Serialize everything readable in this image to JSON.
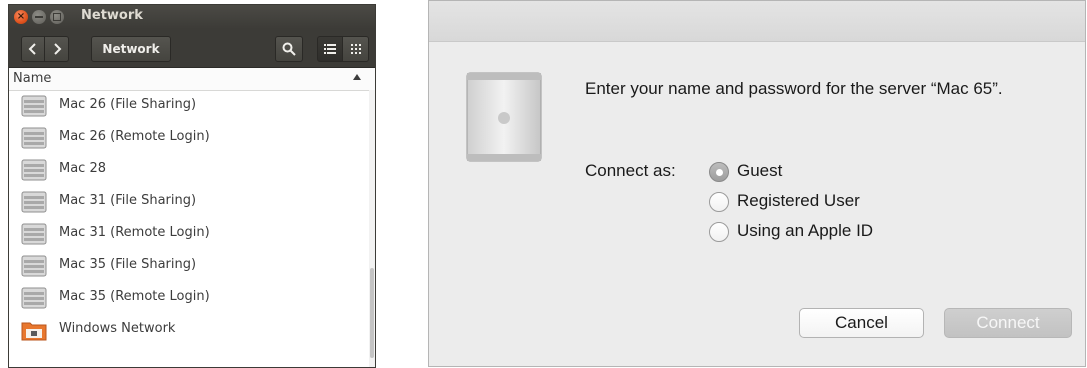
{
  "nautilus": {
    "title": "Network",
    "path_button": "Network",
    "column_header": "Name",
    "items": [
      {
        "label": "Mac 26 (File Sharing)",
        "icon": "server-icon"
      },
      {
        "label": "Mac 26 (Remote Login)",
        "icon": "server-icon"
      },
      {
        "label": "Mac 28",
        "icon": "server-icon"
      },
      {
        "label": "Mac 31 (File Sharing)",
        "icon": "server-icon"
      },
      {
        "label": "Mac 31 (Remote Login)",
        "icon": "server-icon"
      },
      {
        "label": "Mac 35 (File Sharing)",
        "icon": "server-icon"
      },
      {
        "label": "Mac 35 (Remote Login)",
        "icon": "server-icon"
      },
      {
        "label": "Windows Network",
        "icon": "network-folder-icon"
      }
    ],
    "colors": {
      "titlebar": "#3c3b37",
      "close_button": "#e0531e",
      "folder": "#e8772e"
    }
  },
  "dialog": {
    "prompt": "Enter your name and password for the server “Mac 65”.",
    "connect_as_label": "Connect as:",
    "options": [
      {
        "label": "Guest",
        "selected": true
      },
      {
        "label": "Registered User",
        "selected": false
      },
      {
        "label": "Using an Apple ID",
        "selected": false
      }
    ],
    "cancel_label": "Cancel",
    "connect_label": "Connect",
    "connect_enabled": false
  }
}
